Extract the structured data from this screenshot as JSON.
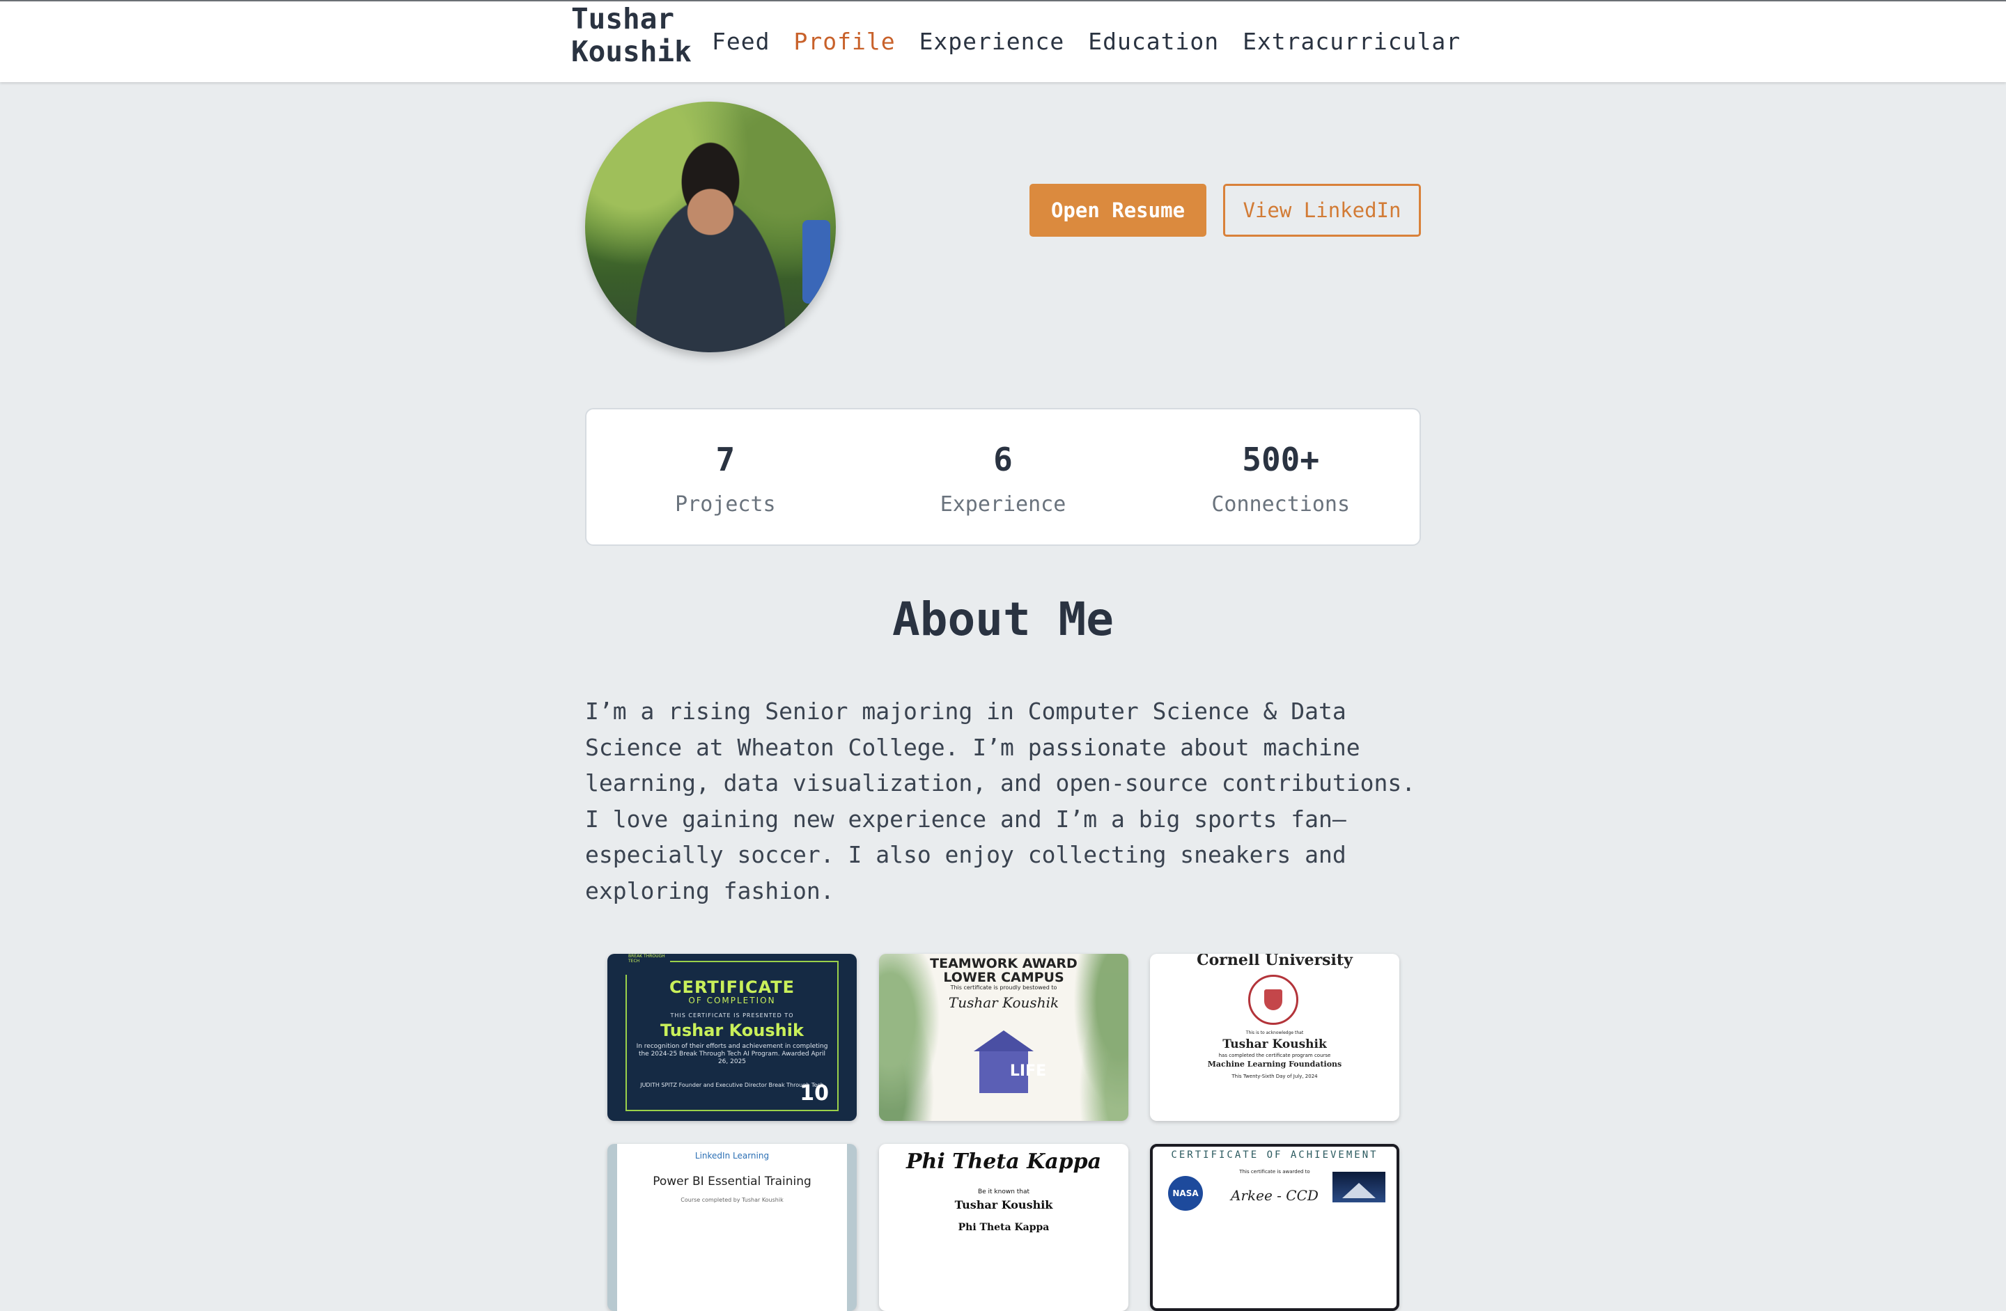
{
  "header": {
    "brand_line1": "Tushar",
    "brand_line2": "Koushik",
    "nav": [
      {
        "label": "Feed",
        "active": false
      },
      {
        "label": "Profile",
        "active": true
      },
      {
        "label": "Experience",
        "active": false
      },
      {
        "label": "Education",
        "active": false
      },
      {
        "label": "Extracurricular",
        "active": false
      }
    ]
  },
  "profile": {
    "avatar_icon": "profile-photo",
    "buttons": {
      "resume_label": "Open Resume",
      "linkedin_label": "View LinkedIn"
    }
  },
  "stats": [
    {
      "value": "7",
      "label": "Projects"
    },
    {
      "value": "6",
      "label": "Experience"
    },
    {
      "value": "500+",
      "label": "Connections"
    }
  ],
  "about": {
    "title": "About Me",
    "text": "I’m a rising Senior majoring in Computer Science & Data Science at Wheaton College. I’m passionate about machine learning, data visualization, and open-source contributions. I love gaining new experience and I’m a big sports fan—especially soccer. I also enjoy collecting sneakers and exploring fashion."
  },
  "certificates": {
    "c1": {
      "corner": "BREAK THROUGH TECH",
      "title": "CERTIFICATE",
      "subtitle": "OF COMPLETION",
      "presented": "THIS CERTIFICATE IS PRESENTED TO",
      "name": "Tushar Koushik",
      "body": "In recognition of their efforts and achievement in completing the 2024-25 Break Through Tech AI Program. Awarded April 26, 2025",
      "signer": "JUDITH SPITZ Founder and Executive Director Break Through Tech",
      "badge": "10"
    },
    "c2": {
      "title_line1": "TEAMWORK AWARD",
      "title_line2": "LOWER CAMPUS",
      "note": "This certificate is proudly bestowed to",
      "name": "Tushar Koushik",
      "logo": "LIFE"
    },
    "c3": {
      "title": "Cornell University",
      "note": "This is to acknowledge that",
      "name": "Tushar Koushik",
      "completed": "has completed the certificate program course",
      "course": "Machine Learning Foundations",
      "date": "This Twenty-Sixth Day of July, 2024"
    },
    "c4": {
      "header": "LinkedIn Learning",
      "course": "Power BI Essential Training",
      "note": "Course completed by Tushar Koushik"
    },
    "c5": {
      "title": "Phi Theta Kappa",
      "note": "Be it known that",
      "name": "Tushar Koushik",
      "society": "Phi Theta Kappa"
    },
    "c6": {
      "title": "CERTIFICATE OF ACHIEVEMENT",
      "note": "This certificate is awarded to",
      "logo": "NASA",
      "name": "Arkee - CCD"
    }
  }
}
